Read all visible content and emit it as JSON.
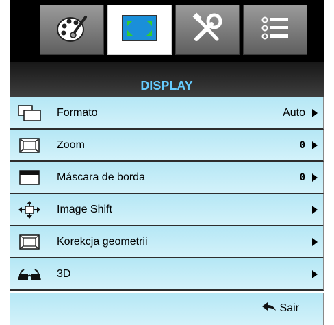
{
  "tabs": [
    {
      "icon": "palette-icon",
      "active": false
    },
    {
      "icon": "display-icon",
      "active": true
    },
    {
      "icon": "tools-icon",
      "active": false
    },
    {
      "icon": "list-icon",
      "active": false
    }
  ],
  "header": {
    "title": "DISPLAY"
  },
  "menu": {
    "items": [
      {
        "label": "Formato",
        "value": "Auto",
        "icon": "aspect-ratio-icon"
      },
      {
        "label": "Zoom",
        "value": "0",
        "icon": "zoom-icon"
      },
      {
        "label": "Máscara de borda",
        "value": "0",
        "icon": "edge-mask-icon"
      },
      {
        "label": "Image Shift",
        "value": "",
        "icon": "image-shift-icon"
      },
      {
        "label": "Korekcja geometrii",
        "value": "",
        "icon": "geometric-correction-icon"
      },
      {
        "label": "3D",
        "value": "",
        "icon": "3d-glasses-icon"
      }
    ]
  },
  "footer": {
    "exit_label": "Sair",
    "icon": "return-arrow-icon"
  },
  "colors": {
    "title": "#66ccff",
    "row_bg": "#c4edf8",
    "active_tab": "#ffffff"
  }
}
